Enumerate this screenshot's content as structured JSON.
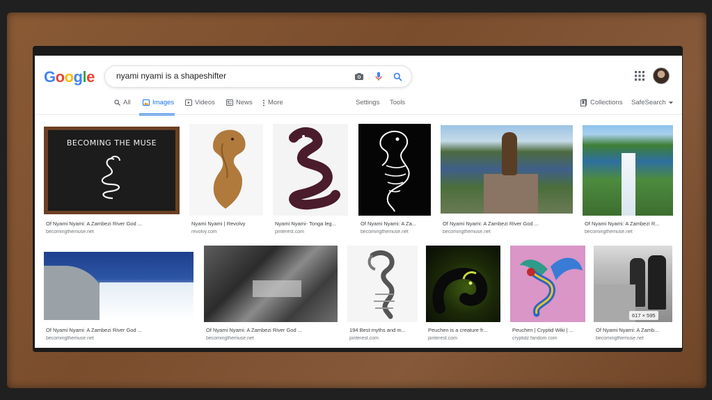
{
  "logo": {
    "letters": [
      "G",
      "o",
      "o",
      "g",
      "l",
      "e"
    ]
  },
  "search": {
    "query": "nyami nyami is a shapeshifter"
  },
  "tabs": [
    {
      "label": "All",
      "icon": "search-icon"
    },
    {
      "label": "Images",
      "icon": "image-icon"
    },
    {
      "label": "Videos",
      "icon": "play-icon"
    },
    {
      "label": "News",
      "icon": "news-icon"
    },
    {
      "label": "More",
      "icon": "more-vert-icon"
    },
    {
      "label": "Settings"
    },
    {
      "label": "Tools"
    }
  ],
  "right_tools": {
    "collections": "Collections",
    "safesearch": "SafeSearch"
  },
  "results": [
    {
      "title": "Of Nyami Nyami: A Zambezi River God ...",
      "domain": "becomingthemuse.net",
      "image_text": "BECOMING THE MUSE"
    },
    {
      "title": "Nyami Nyami | Revolvy",
      "domain": "revolvy.com"
    },
    {
      "title": "Nyami Nyami- Tonga leg...",
      "domain": "pinterest.com"
    },
    {
      "title": "Of Nyami Nyami: A Za...",
      "domain": "becomingthemuse.net"
    },
    {
      "title": "Of Nyami Nyami: A Zambezi River God ...",
      "domain": "becomingthemuse.net"
    },
    {
      "title": "Of Nyami Nyami: A Zambezi R...",
      "domain": "becomingthemuse.net"
    },
    {
      "title": "Of Nyami Nyami: A Zambezi River God ...",
      "domain": "becomingthemuse.net"
    },
    {
      "title": "Of Nyami Nyami: A Zambezi River God ...",
      "domain": "becomingthemuse.net"
    },
    {
      "title": "194 Best myths and m...",
      "domain": "pinterest.com"
    },
    {
      "title": "Peuchen is a creature fr...",
      "domain": "pinterest.com"
    },
    {
      "title": "Peuchen | Cryptid Wiki | ...",
      "domain": "cryptidz.fandom.com"
    },
    {
      "title": "Of Nyami Nyami: A Zamb...",
      "domain": "becomingthemuse.net"
    }
  ],
  "hover_dimensions": "617 × 595"
}
